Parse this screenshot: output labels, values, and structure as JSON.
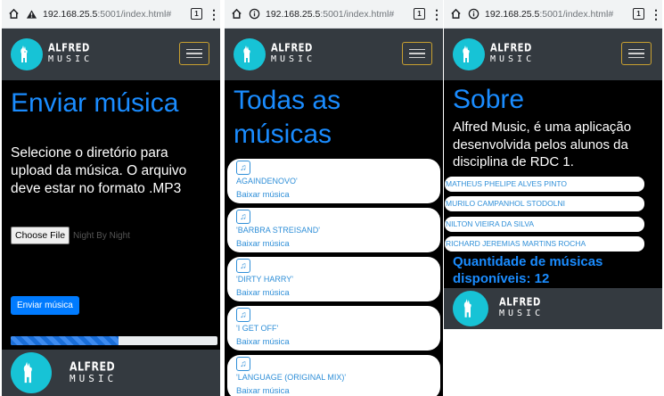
{
  "browser": {
    "url_host": "192.168.25.5",
    "url_rest": ":5001/index.html#",
    "tab_count": "1"
  },
  "brand": {
    "line1": "ALFRED",
    "line2": "MUSIC"
  },
  "upload": {
    "title": "Enviar música",
    "description": "Selecione o diretório para upload da música. O arquivo deve estar no formato .MP3",
    "file_button": "Choose File",
    "file_name": "Night By Night",
    "submit_label": "Enviar música",
    "progress": 0.52
  },
  "songs": {
    "title": "Todas as músicas",
    "download_label": "Baixar música",
    "items": [
      {
        "name": "AGAINDENOVO'"
      },
      {
        "name": "'BARBRA STREISAND'"
      },
      {
        "name": "'DIRTY HARRY'"
      },
      {
        "name": "'I GET OFF'"
      },
      {
        "name": "'LANGUAGE (ORIGINAL MIX)'"
      }
    ]
  },
  "about": {
    "title": "Sobre",
    "description": "Alfred Music, é uma aplicação desenvolvida pelos alunos da disciplina de RDC 1.",
    "members": [
      "MATHEUS PHELIPE ALVES PINTO",
      "MURILO CAMPANHOL STODOLNI",
      "NILTON VIEIRA DA SILVA",
      "RICHARD JEREMIAS MARTINS ROCHA"
    ],
    "count_label": "Quantidade de músicas disponíveis: 12"
  },
  "colors": {
    "accent": "#1a8cff",
    "navbar": "#343a40",
    "logo": "#17c3d6",
    "toggler_border": "#c8a030"
  },
  "icons": [
    "home-icon",
    "info-icon",
    "tabs-icon",
    "more-icon",
    "llama-logo-icon",
    "music-note-icon",
    "hamburger-icon"
  ]
}
